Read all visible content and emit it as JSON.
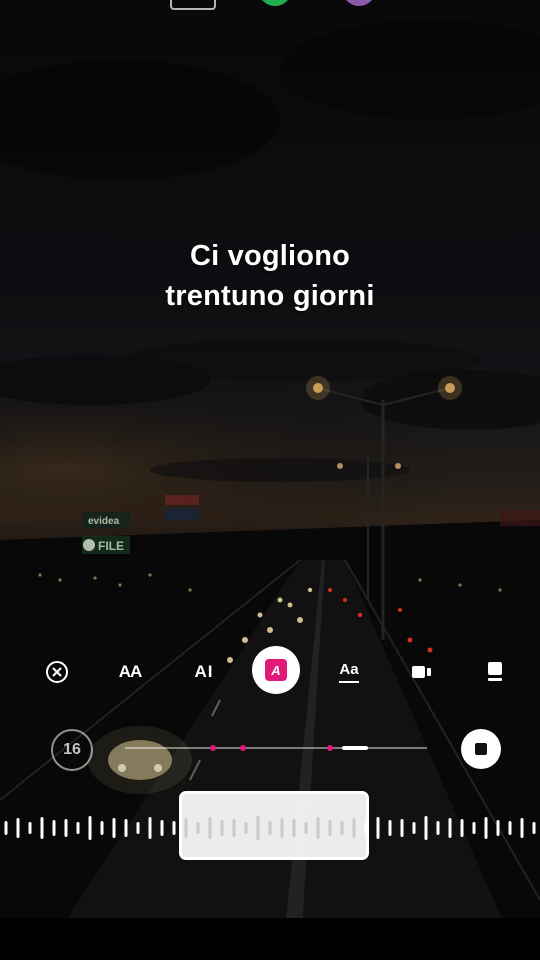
{
  "lyrics": {
    "line1": "Ci vogliono",
    "line2": "trentuno giorni"
  },
  "toolbar": {
    "items": [
      {
        "name": "close-icon"
      },
      {
        "name": "text-style-icon",
        "label": "AA"
      },
      {
        "name": "ai-style-icon",
        "label": "AI"
      },
      {
        "name": "font-style-icon",
        "label": "A",
        "selected": true
      },
      {
        "name": "effect-icon",
        "label": "Aa"
      },
      {
        "name": "video-icon"
      },
      {
        "name": "layout-icon"
      }
    ]
  },
  "player": {
    "duration_badge": "16",
    "progress_fraction": 0.72,
    "markers": [
      0.29,
      0.39,
      0.68
    ]
  },
  "colors": {
    "accent": "#e0197a",
    "text": "#ffffff"
  }
}
